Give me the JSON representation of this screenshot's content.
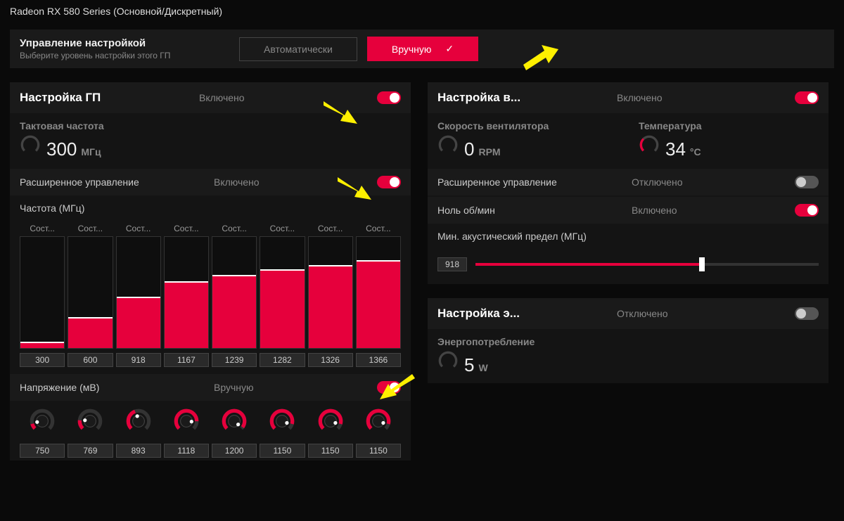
{
  "title": "Radeon RX 580 Series (Основной/Дискретный)",
  "control": {
    "label": "Управление настройкой",
    "sub": "Выберите уровень настройки этого ГП",
    "auto": "Автоматически",
    "manual": "Вручную"
  },
  "gpu": {
    "title": "Настройка ГП",
    "status": "Включено",
    "freq_label": "Тактовая частота",
    "freq_val": "300",
    "freq_unit": "МГц",
    "adv_label": "Расширенное управление",
    "adv_val": "Включено",
    "chart_label": "Частота (МГц)",
    "states": [
      {
        "head": "Сост...",
        "val": "300",
        "pct": 6
      },
      {
        "head": "Сост...",
        "val": "600",
        "pct": 28
      },
      {
        "head": "Сост...",
        "val": "918",
        "pct": 46
      },
      {
        "head": "Сост...",
        "val": "1167",
        "pct": 60
      },
      {
        "head": "Сост...",
        "val": "1239",
        "pct": 66
      },
      {
        "head": "Сост...",
        "val": "1282",
        "pct": 71
      },
      {
        "head": "Сост...",
        "val": "1326",
        "pct": 75
      },
      {
        "head": "Сост...",
        "val": "1366",
        "pct": 79
      }
    ],
    "volt_label": "Напряжение (мВ)",
    "volt_mode": "Вручную",
    "volts": [
      {
        "val": "750",
        "ang": 30
      },
      {
        "val": "769",
        "ang": 50
      },
      {
        "val": "893",
        "ang": 115
      },
      {
        "val": "1118",
        "ang": 225
      },
      {
        "val": "1200",
        "ang": 260
      },
      {
        "val": "1150",
        "ang": 240
      },
      {
        "val": "1150",
        "ang": 240
      },
      {
        "val": "1150",
        "ang": 240
      }
    ]
  },
  "fan": {
    "title": "Настройка в...",
    "status": "Включено",
    "speed_label": "Скорость вентилятора",
    "speed_val": "0",
    "speed_unit": "RPM",
    "temp_label": "Температура",
    "temp_val": "34",
    "temp_unit": "°C",
    "adv_label": "Расширенное управление",
    "adv_val": "Отключено",
    "zero_label": "Ноль об/мин",
    "zero_val": "Включено",
    "acoustic_label": "Мин. акустический предел (МГц)",
    "acoustic_val": "918",
    "acoustic_pct": 66
  },
  "power": {
    "title": "Настройка э...",
    "status": "Отключено",
    "cons_label": "Энергопотребление",
    "cons_val": "5",
    "cons_unit": "W"
  },
  "colors": {
    "accent": "#e6003c"
  }
}
